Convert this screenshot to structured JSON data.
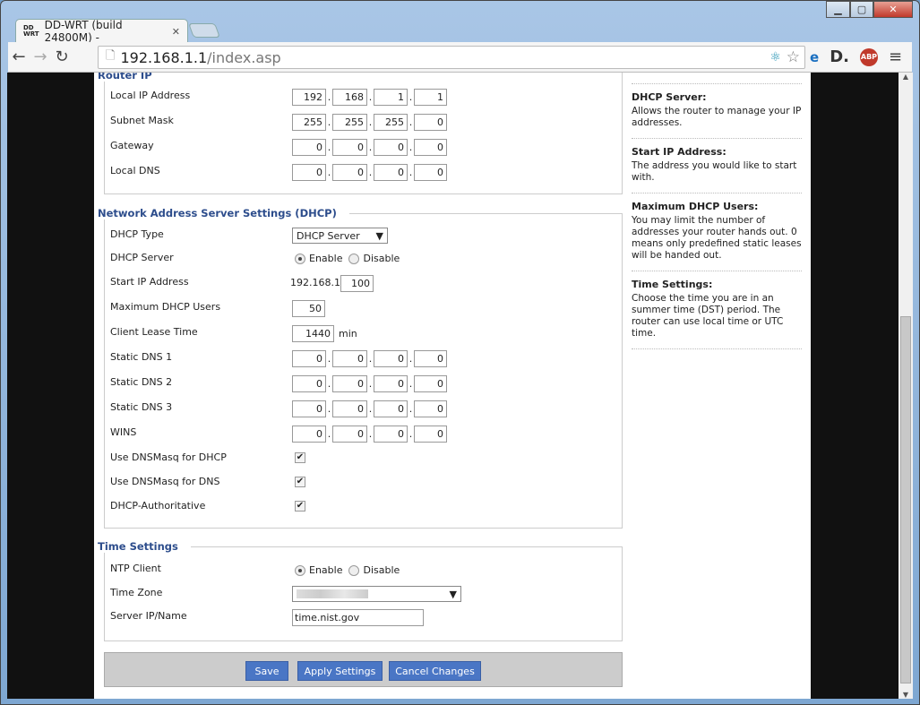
{
  "browser": {
    "tab_title": "DD-WRT (build 24800M) -",
    "url_host": "192.168.1.1",
    "url_path": "/index.asp"
  },
  "router_ip": {
    "legend": "Router IP",
    "rows": [
      {
        "label": "Local IP Address",
        "octets": [
          "192",
          "168",
          "1",
          "1"
        ]
      },
      {
        "label": "Subnet Mask",
        "octets": [
          "255",
          "255",
          "255",
          "0"
        ]
      },
      {
        "label": "Gateway",
        "octets": [
          "0",
          "0",
          "0",
          "0"
        ]
      },
      {
        "label": "Local DNS",
        "octets": [
          "0",
          "0",
          "0",
          "0"
        ]
      }
    ]
  },
  "dhcp": {
    "legend": "Network Address Server Settings (DHCP)",
    "type_label": "DHCP Type",
    "type_value": "DHCP Server",
    "server_label": "DHCP Server",
    "enable": "Enable",
    "disable": "Disable",
    "server_enabled": true,
    "start_label": "Start IP Address",
    "start_prefix": "192.168.1.",
    "start_value": "100",
    "max_label": "Maximum DHCP Users",
    "max_value": "50",
    "lease_label": "Client Lease Time",
    "lease_value": "1440",
    "lease_unit": "min",
    "dns_rows": [
      {
        "label": "Static DNS 1",
        "octets": [
          "0",
          "0",
          "0",
          "0"
        ]
      },
      {
        "label": "Static DNS 2",
        "octets": [
          "0",
          "0",
          "0",
          "0"
        ]
      },
      {
        "label": "Static DNS 3",
        "octets": [
          "0",
          "0",
          "0",
          "0"
        ]
      },
      {
        "label": "WINS",
        "octets": [
          "0",
          "0",
          "0",
          "0"
        ]
      }
    ],
    "checks": [
      {
        "label": "Use DNSMasq for DHCP",
        "checked": true
      },
      {
        "label": "Use DNSMasq for DNS",
        "checked": true
      },
      {
        "label": "DHCP-Authoritative",
        "checked": true
      }
    ]
  },
  "time": {
    "legend": "Time Settings",
    "ntp_label": "NTP Client",
    "enable": "Enable",
    "disable": "Disable",
    "ntp_enabled": true,
    "tz_label": "Time Zone",
    "server_label": "Server IP/Name",
    "server_value": "time.nist.gov"
  },
  "buttons": {
    "save": "Save",
    "apply": "Apply Settings",
    "cancel": "Cancel Changes"
  },
  "help": [
    {
      "title": "DHCP Server:",
      "text": "Allows the router to manage your IP addresses."
    },
    {
      "title": "Start IP Address:",
      "text": "The address you would like to start with."
    },
    {
      "title": "Maximum DHCP Users:",
      "text": "You may limit the number of addresses your router hands out. 0 means only predefined static leases will be handed out."
    },
    {
      "title": "Time Settings:",
      "text": "Choose the time you are in an summer time (DST) period. The router can use local time or UTC time."
    }
  ]
}
